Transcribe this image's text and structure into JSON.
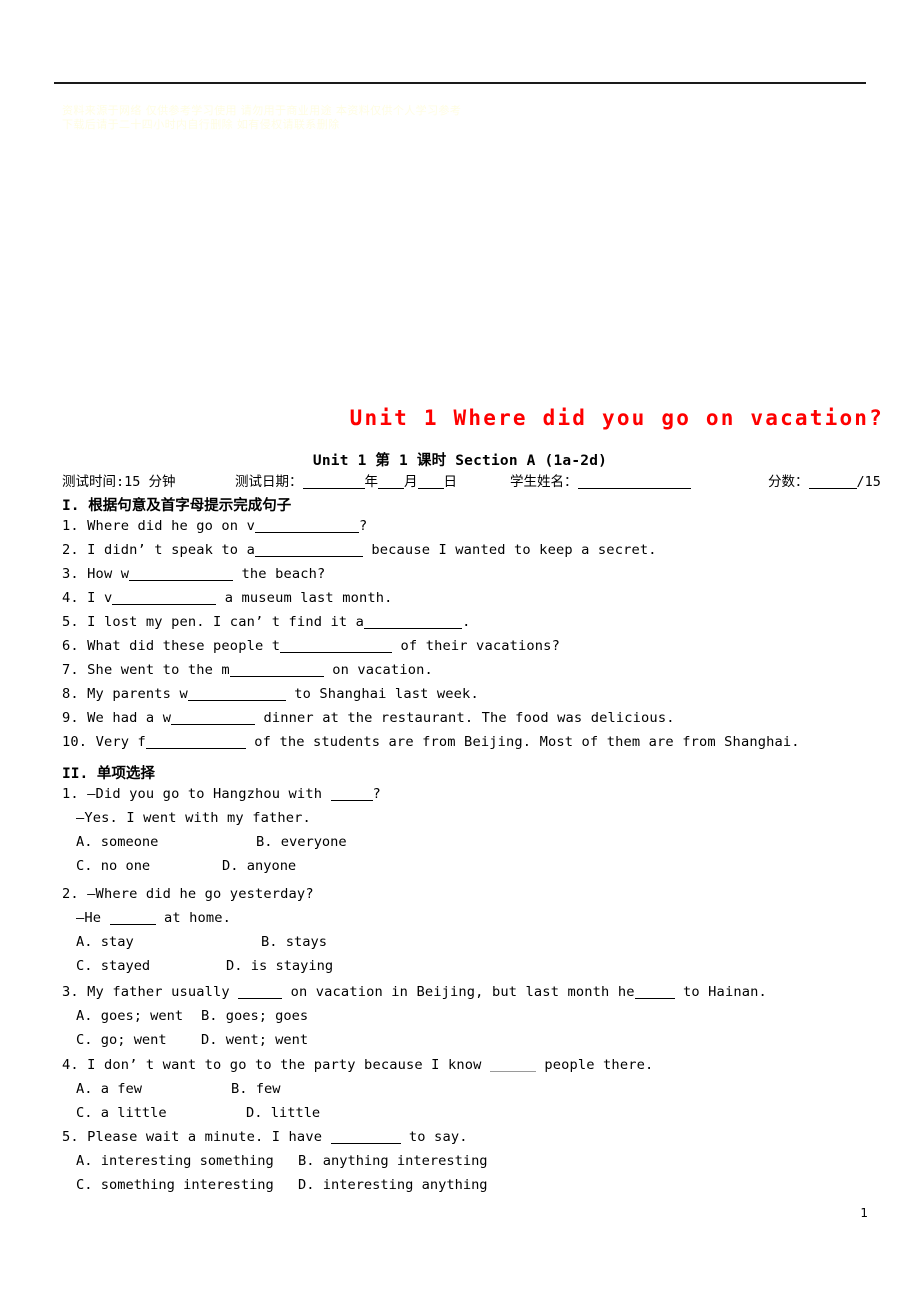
{
  "document": {
    "watermark_text": "资料来源于网络 仅供参考学习使用 请勿用于商业用途 本资料仅供个人学习参考 下载后请于二十四小时内自行删除 如有侵权请联系删除",
    "unit_title": "Unit 1 Where did you go on vacation?",
    "sub_title": "Unit 1 第 1 课时 Section A (1a-2d)",
    "page_number": "1"
  },
  "meta": {
    "test_time_label": "测试时间:15 分钟",
    "test_date_label": "测试日期：",
    "date_year": "年",
    "date_month": "月",
    "date_day": "日",
    "student_name_label": "学生姓名：",
    "score_label": "分数：",
    "score_total": "/15"
  },
  "section1": {
    "heading": "I. 根据句意及首字母提示完成句子",
    "questions": [
      {
        "num": "1.",
        "pre": "Where did he go on",
        "hint": "v",
        "post": "?"
      },
      {
        "num": "2.",
        "pre": "I didn’ t speak to",
        "hint": "a",
        "post": "because I wanted to keep a secret."
      },
      {
        "num": "3.",
        "pre": "How",
        "hint": "w",
        "post": "the beach?"
      },
      {
        "num": "4.",
        "pre": "I",
        "hint": "v",
        "post": "a museum last month."
      },
      {
        "num": "5.",
        "pre": "I lost my pen. I can’ t find it",
        "hint": "a",
        "post": "."
      },
      {
        "num": "6.",
        "pre": "What did these people",
        "hint": "t",
        "post": "of their vacations?"
      },
      {
        "num": "7.",
        "pre": "She went to the",
        "hint": "m",
        "post": "on vacation."
      },
      {
        "num": "8.",
        "pre": "My parents",
        "hint": "w",
        "post": "to Shanghai last week."
      },
      {
        "num": "9.",
        "pre": "We had a",
        "hint": "w",
        "post": "dinner at the restaurant. The food was delicious."
      },
      {
        "num": "10.",
        "pre": "Very",
        "hint": "f",
        "post": "of the students are from Beijing. Most of them are from Shanghai."
      }
    ]
  },
  "section2": {
    "heading": "II. 单项选择",
    "questions": [
      {
        "num": "1.",
        "stem_pre": "—Did you go to Hangzhou with",
        "stem_post": "?",
        "stem_line2": "—Yes. I went with my father.",
        "options": [
          {
            "label": "A.",
            "text": "someone"
          },
          {
            "label": "B.",
            "text": "everyone"
          },
          {
            "label": "C.",
            "text": "no one"
          },
          {
            "label": "D.",
            "text": "anyone"
          }
        ]
      },
      {
        "num": "2.",
        "stem_pre": "—Where did he go yesterday?",
        "stem_post": "",
        "stem_line2_pre": "—He",
        "stem_line2_post": "at home.",
        "options": [
          {
            "label": "A.",
            "text": "stay"
          },
          {
            "label": "B.",
            "text": "stays"
          },
          {
            "label": "C.",
            "text": "stayed"
          },
          {
            "label": "D.",
            "text": "is staying"
          }
        ]
      },
      {
        "num": "3.",
        "stem_pre": "My father usually",
        "stem_mid": "on vacation in Beijing, but last month he",
        "stem_post": "to Hainan.",
        "options": [
          {
            "label": "A.",
            "text": "goes; went"
          },
          {
            "label": "B.",
            "text": "goes; goes"
          },
          {
            "label": "C.",
            "text": "go; went"
          },
          {
            "label": "D.",
            "text": "went; went"
          }
        ]
      },
      {
        "num": "4.",
        "stem_pre": "I don’ t want to go to the party because I know",
        "stem_post": "people there.",
        "options": [
          {
            "label": "A.",
            "text": "a few"
          },
          {
            "label": "B.",
            "text": "few"
          },
          {
            "label": "C.",
            "text": "a little"
          },
          {
            "label": "D.",
            "text": "little"
          }
        ]
      },
      {
        "num": "5.",
        "stem_pre": "Please wait a minute. I have",
        "stem_post": "to say.",
        "options": [
          {
            "label": "A.",
            "text": "interesting something"
          },
          {
            "label": "B.",
            "text": "anything interesting"
          },
          {
            "label": "C.",
            "text": "something interesting"
          },
          {
            "label": "D.",
            "text": "interesting anything"
          }
        ]
      }
    ]
  }
}
